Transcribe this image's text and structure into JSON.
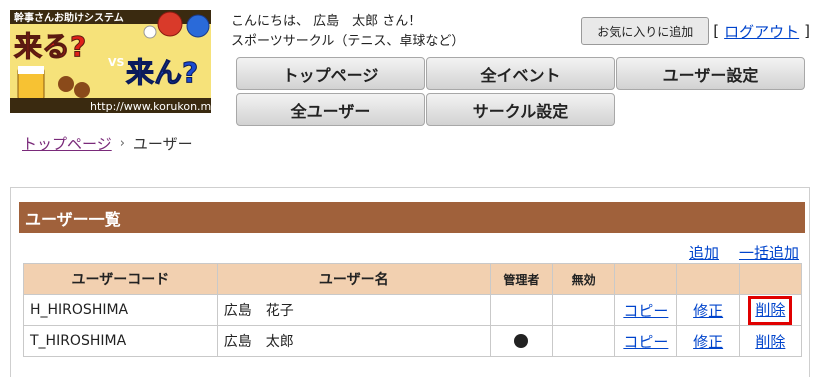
{
  "logo": {
    "tagline": "幹事さんお助けシステム",
    "word1": "来る?",
    "vs": "VS",
    "word2": "来ん?",
    "url": "http://www.korukon.me"
  },
  "header": {
    "greeting": "こんにちは、 広島　太郎 さん！",
    "circle_name": "スポーツサークル（テニス、卓球など）",
    "favorite_button": "お気に入りに追加",
    "bracket_open": "[",
    "logout_label": "ログアウト",
    "bracket_close": "]"
  },
  "nav": {
    "top_page": "トップページ",
    "all_events": "全イベント",
    "user_settings": "ユーザー設定",
    "all_users": "全ユーザー",
    "circle_settings": "サークル設定"
  },
  "breadcrumb": {
    "home": "トップページ",
    "separator": "›",
    "current": "ユーザー"
  },
  "panel": {
    "title": "ユーザー一覧",
    "add_label": "追加",
    "bulk_add_label": "一括追加"
  },
  "table": {
    "headers": {
      "user_code": "ユーザーコード",
      "user_name": "ユーザー名",
      "admin": "管理者",
      "disabled": "無効"
    },
    "rows": [
      {
        "code": "H_HIROSHIMA",
        "name": "広島　花子",
        "admin": false,
        "copy": "コピー",
        "edit": "修正",
        "delete": "削除"
      },
      {
        "code": "T_HIROSHIMA",
        "name": "広島　太郎",
        "admin": true,
        "copy": "コピー",
        "edit": "修正",
        "delete": "削除"
      }
    ]
  },
  "colors": {
    "panel_header": "#a0613b",
    "table_header": "#f2d0b0",
    "link": "#0044cc",
    "highlight": "#e00000"
  }
}
